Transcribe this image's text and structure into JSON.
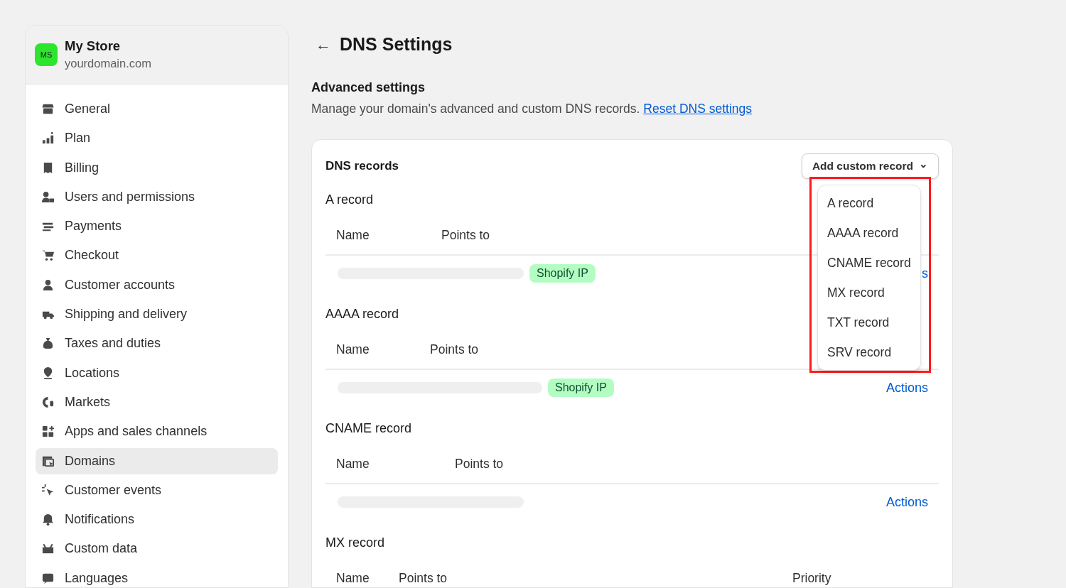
{
  "store": {
    "initials": "MS",
    "name": "My Store",
    "domain": "yourdomain.com"
  },
  "sidebar": {
    "items": [
      {
        "label": "General",
        "selected": false
      },
      {
        "label": "Plan",
        "selected": false
      },
      {
        "label": "Billing",
        "selected": false
      },
      {
        "label": "Users and permissions",
        "selected": false
      },
      {
        "label": "Payments",
        "selected": false
      },
      {
        "label": "Checkout",
        "selected": false
      },
      {
        "label": "Customer accounts",
        "selected": false
      },
      {
        "label": "Shipping and delivery",
        "selected": false
      },
      {
        "label": "Taxes and duties",
        "selected": false
      },
      {
        "label": "Locations",
        "selected": false
      },
      {
        "label": "Markets",
        "selected": false
      },
      {
        "label": "Apps and sales channels",
        "selected": false
      },
      {
        "label": "Domains",
        "selected": true
      },
      {
        "label": "Customer events",
        "selected": false
      },
      {
        "label": "Notifications",
        "selected": false
      },
      {
        "label": "Custom data",
        "selected": false
      },
      {
        "label": "Languages",
        "selected": false
      }
    ]
  },
  "page": {
    "back": "←",
    "title": "DNS Settings",
    "section_title": "Advanced settings",
    "description": "Manage your domain's advanced and custom DNS records.",
    "reset_link": "Reset DNS settings"
  },
  "dns_card": {
    "title": "DNS records",
    "add_button": "Add custom record",
    "add_caret": "⌄",
    "sections": [
      {
        "title": "A record",
        "columns": [
          "Name",
          "Points to"
        ],
        "rows": [
          {
            "badge": "Shopify IP",
            "action": "s"
          }
        ]
      },
      {
        "title": "AAAA record",
        "columns": [
          "Name",
          "Points to"
        ],
        "rows": [
          {
            "badge": "Shopify IP",
            "action": "Actions"
          }
        ]
      },
      {
        "title": "CNAME record",
        "columns": [
          "Name",
          "Points to"
        ],
        "rows": [
          {
            "action": "Actions"
          }
        ]
      },
      {
        "title": "MX record",
        "columns": [
          "Name",
          "Points to",
          "Priority"
        ]
      }
    ]
  },
  "dropdown": {
    "highlighted": true,
    "items": [
      "A record",
      "AAAA record",
      "CNAME record",
      "MX record",
      "TXT record",
      "SRV record"
    ]
  }
}
